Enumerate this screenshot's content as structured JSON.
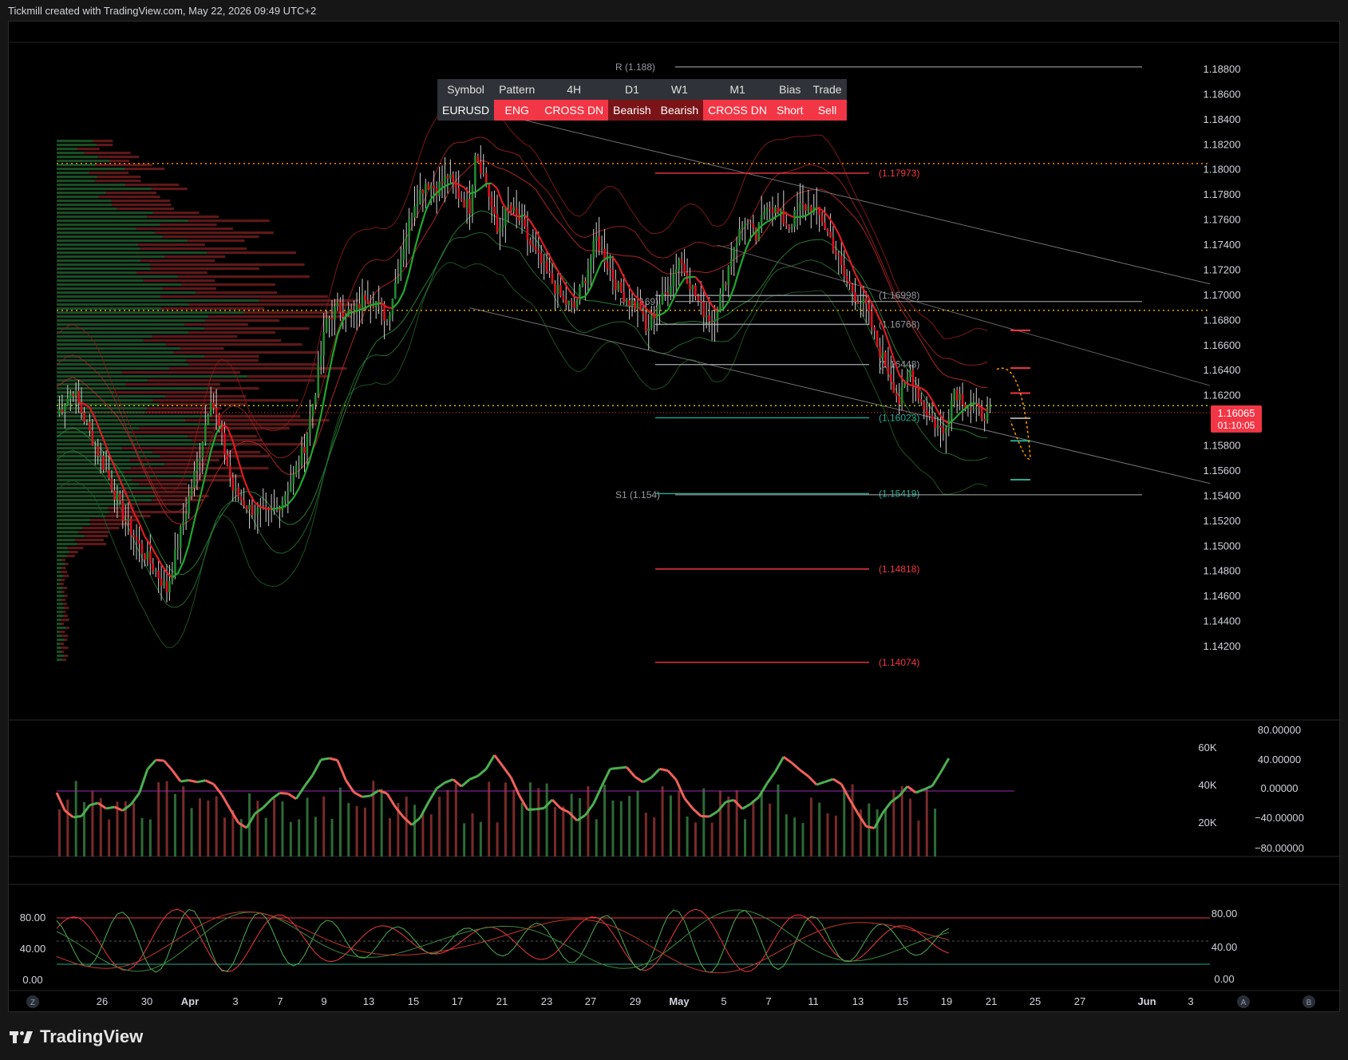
{
  "header": {
    "text": "Tickmill created with TradingView.com, May 22, 2026 09:49 UTC+2"
  },
  "brand": {
    "name": "TradingView"
  },
  "signal_table": {
    "headers": [
      "Symbol",
      "Pattern",
      "4H",
      "D1",
      "W1",
      "M1",
      "Bias",
      "Trade"
    ],
    "values": [
      "EURUSD",
      "ENG",
      "CROSS DN",
      "Bearish",
      "Bearish",
      "CROSS DN",
      "Short",
      "Sell"
    ],
    "value_colors": [
      "#2f3238",
      "#f23645",
      "#f23645",
      "#7a1418",
      "#7a1418",
      "#f23645",
      "#f23645",
      "#f23645"
    ]
  },
  "price_axis": {
    "ticks": [
      "1.18800",
      "1.18600",
      "1.18400",
      "1.18200",
      "1.18000",
      "1.17800",
      "1.17600",
      "1.17400",
      "1.17200",
      "1.17000",
      "1.16800",
      "1.16600",
      "1.16400",
      "1.16200",
      "1.15800",
      "1.15600",
      "1.15400",
      "1.15200",
      "1.15000",
      "1.14800",
      "1.14600",
      "1.14400",
      "1.14200"
    ],
    "current_price": "1.16065",
    "countdown": "01:10:05",
    "current_color": "#f23645"
  },
  "levels": [
    {
      "label": "(1.17973)",
      "value": 1.17973,
      "color": "#f23645"
    },
    {
      "label": "(1.16998)",
      "value": 1.16998,
      "color": "#9598a1"
    },
    {
      "label": "(1.16768)",
      "value": 1.16768,
      "color": "#9598a1"
    },
    {
      "label": "(1.16448)",
      "value": 1.16448,
      "color": "#9598a1"
    },
    {
      "label": "(1.16023)",
      "value": 1.16023,
      "color": "#22ab94"
    },
    {
      "label": "(1.15419)",
      "value": 1.15419,
      "color": "#22ab94"
    },
    {
      "label": "(1.14818)",
      "value": 1.14818,
      "color": "#f23645"
    },
    {
      "label": "(1.14074)",
      "value": 1.14074,
      "color": "#f23645"
    }
  ],
  "pivot_labels": {
    "s1": "S1 (1.154)",
    "p": "P (1.169)",
    "r": "R (1.188)"
  },
  "volume_axis": {
    "ticks": [
      "60K",
      "40K",
      "20K"
    ]
  },
  "osc_axis": {
    "ticks": [
      "80.00000",
      "40.00000",
      "0.00000",
      "−40.00000",
      "−80.00000"
    ]
  },
  "stoch_axis": {
    "left": [
      "80.00",
      "40.00",
      "0.00"
    ],
    "right": [
      "80.00",
      "40.00",
      "0.00"
    ]
  },
  "time_axis": {
    "labels": [
      {
        "t": "26",
        "x": 117
      },
      {
        "t": "30",
        "x": 173
      },
      {
        "t": "Apr",
        "x": 227
      },
      {
        "t": "3",
        "x": 284
      },
      {
        "t": "7",
        "x": 340
      },
      {
        "t": "9",
        "x": 395
      },
      {
        "t": "13",
        "x": 451
      },
      {
        "t": "15",
        "x": 507
      },
      {
        "t": "17",
        "x": 562
      },
      {
        "t": "21",
        "x": 618
      },
      {
        "t": "23",
        "x": 674
      },
      {
        "t": "27",
        "x": 729
      },
      {
        "t": "29",
        "x": 785
      },
      {
        "t": "May",
        "x": 840
      },
      {
        "t": "5",
        "x": 896
      },
      {
        "t": "7",
        "x": 952
      },
      {
        "t": "11",
        "x": 1008
      },
      {
        "t": "13",
        "x": 1064
      },
      {
        "t": "15",
        "x": 1120
      },
      {
        "t": "19",
        "x": 1175
      },
      {
        "t": "21",
        "x": 1231
      },
      {
        "t": "25",
        "x": 1286
      },
      {
        "t": "27",
        "x": 1342
      },
      {
        "t": "Jun",
        "x": 1426
      },
      {
        "t": "3",
        "x": 1481
      }
    ],
    "corner_left": "Z",
    "corner_a": "A",
    "corner_b": "B"
  },
  "chart_data": {
    "type": "candlestick",
    "symbol": "EURUSD",
    "x_range": [
      "Mar 24",
      "Jun 4"
    ],
    "ylim": [
      1.14,
      1.19
    ],
    "close_path": [
      [
        0,
        1.1605
      ],
      [
        6,
        1.1625
      ],
      [
        12,
        1.159
      ],
      [
        18,
        1.156
      ],
      [
        24,
        1.1525
      ],
      [
        30,
        1.15
      ],
      [
        36,
        1.148
      ],
      [
        40,
        1.1465
      ],
      [
        46,
        1.152
      ],
      [
        52,
        1.1575
      ],
      [
        56,
        1.162
      ],
      [
        60,
        1.1585
      ],
      [
        64,
        1.1545
      ],
      [
        70,
        1.153
      ],
      [
        76,
        1.1525
      ],
      [
        80,
        1.153
      ],
      [
        86,
        1.1555
      ],
      [
        90,
        1.158
      ],
      [
        94,
        1.1625
      ],
      [
        98,
        1.168
      ],
      [
        102,
        1.169
      ],
      [
        108,
        1.1685
      ],
      [
        112,
        1.17
      ],
      [
        116,
        1.1695
      ],
      [
        120,
        1.168
      ],
      [
        126,
        1.174
      ],
      [
        130,
        1.1775
      ],
      [
        134,
        1.179
      ],
      [
        138,
        1.1785
      ],
      [
        142,
        1.1795
      ],
      [
        146,
        1.178
      ],
      [
        150,
        1.177
      ],
      [
        152,
        1.1815
      ],
      [
        156,
        1.179
      ],
      [
        160,
        1.175
      ],
      [
        164,
        1.177
      ],
      [
        168,
        1.176
      ],
      [
        172,
        1.174
      ],
      [
        176,
        1.1725
      ],
      [
        180,
        1.171
      ],
      [
        184,
        1.1695
      ],
      [
        188,
        1.169
      ],
      [
        192,
        1.1715
      ],
      [
        196,
        1.1745
      ],
      [
        200,
        1.1725
      ],
      [
        204,
        1.1705
      ],
      [
        208,
        1.1695
      ],
      [
        212,
        1.169
      ],
      [
        214,
        1.167
      ],
      [
        218,
        1.169
      ],
      [
        222,
        1.1705
      ],
      [
        226,
        1.173
      ],
      [
        230,
        1.171
      ],
      [
        234,
        1.169
      ],
      [
        238,
        1.168
      ],
      [
        242,
        1.1705
      ],
      [
        246,
        1.174
      ],
      [
        250,
        1.176
      ],
      [
        254,
        1.1745
      ],
      [
        258,
        1.1775
      ],
      [
        262,
        1.1765
      ],
      [
        266,
        1.1755
      ],
      [
        270,
        1.177
      ],
      [
        274,
        1.177
      ],
      [
        278,
        1.176
      ],
      [
        282,
        1.174
      ],
      [
        286,
        1.1715
      ],
      [
        290,
        1.17
      ],
      [
        294,
        1.169
      ],
      [
        298,
        1.166
      ],
      [
        302,
        1.164
      ],
      [
        306,
        1.1615
      ],
      [
        310,
        1.164
      ],
      [
        314,
        1.1615
      ],
      [
        318,
        1.16
      ],
      [
        322,
        1.159
      ],
      [
        326,
        1.1625
      ],
      [
        330,
        1.1615
      ],
      [
        334,
        1.1605
      ],
      [
        338,
        1.1606
      ]
    ]
  },
  "colors": {
    "up": "#22ab94",
    "down": "#f23645",
    "candle_up": "#1e8c2e",
    "candle_down": "#e01020",
    "osc_up": "#4caf50",
    "osc_down": "#f0605a",
    "purple": "#9c27b0"
  }
}
